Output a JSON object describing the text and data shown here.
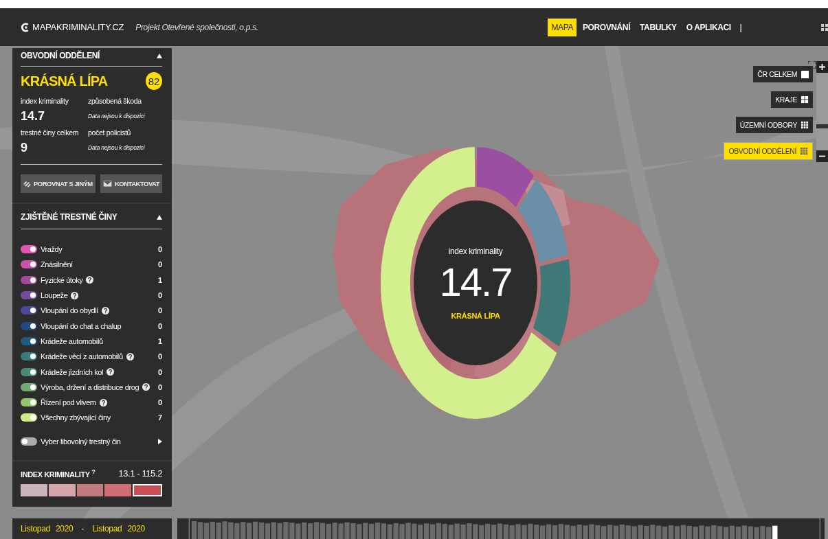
{
  "topbar": {
    "logo": "MAPAKRIMINALITY.CZ",
    "tagline": "Projekt Otevřené společnosti, o.p.s.",
    "separator": "|",
    "nav": [
      {
        "label": "MAPA",
        "selected": true
      },
      {
        "label": "POROVNÁNÍ",
        "selected": false
      },
      {
        "label": "TABULKY",
        "selected": false
      },
      {
        "label": "O APLIKACI",
        "selected": false
      }
    ]
  },
  "panel": {
    "section": "OBVODNÍ ODDĚLENÍ",
    "section_expanded": true,
    "place": "KRÁSNÁ LÍPA",
    "rank": "82",
    "stats": [
      {
        "label": "index kriminality",
        "value": "14.7",
        "kind": "value"
      },
      {
        "label": "způsobená škoda",
        "value": "Data nejsou k dispozici",
        "kind": "note"
      },
      {
        "label": "trestné činy celkem",
        "value": "9",
        "kind": "value"
      },
      {
        "label": "počet policistů",
        "value": "Data nejsou k dispozici",
        "kind": "note"
      }
    ],
    "buttons": [
      {
        "label": "POROVNAT S JINÝM",
        "kind": "compare"
      },
      {
        "label": "KONTAKTOVAT",
        "kind": "contact"
      }
    ],
    "crimes": {
      "title": "ZJIŠTĚNÉ TRESTNÉ ČINY",
      "expanded": true,
      "items": [
        {
          "label": "Vraždy",
          "count": "0",
          "color": "#e055b5",
          "on": true,
          "help": false
        },
        {
          "label": "Znásilnění",
          "count": "0",
          "color": "#c852a8",
          "on": true,
          "help": false
        },
        {
          "label": "Fyzické útoky",
          "count": "1",
          "color": "#a04a9e",
          "on": true,
          "help": true
        },
        {
          "label": "Loupeže",
          "count": "0",
          "color": "#7a4a9a",
          "on": true,
          "help": true
        },
        {
          "label": "Vloupání do obydlí",
          "count": "0",
          "color": "#4a4a95",
          "on": true,
          "help": true
        },
        {
          "label": "Vloupání do chat a chalup",
          "count": "0",
          "color": "#1f4a82",
          "on": true,
          "help": false
        },
        {
          "label": "Krádeže automobilů",
          "count": "1",
          "color": "#1f5a80",
          "on": true,
          "help": false
        },
        {
          "label": "Krádeže věcí z automobilů",
          "count": "0",
          "color": "#3a7a7c",
          "on": true,
          "help": true
        },
        {
          "label": "Krádeže jízdních kol",
          "count": "0",
          "color": "#4a8a72",
          "on": true,
          "help": true
        },
        {
          "label": "Výroba, držení a distribuce drog",
          "count": "0",
          "color": "#72a872",
          "on": true,
          "help": true
        },
        {
          "label": "Řízení pod vlivem",
          "count": "0",
          "color": "#94c672",
          "on": true,
          "help": true
        },
        {
          "label": "Všechny zbývající činy",
          "count": "7",
          "color": "#cbea86",
          "on": true,
          "help": false
        }
      ],
      "picker": {
        "label": "Vyber libovolný trestný čin",
        "on": false
      }
    },
    "index_legend": {
      "title": "INDEX KRIMINALITY $^{?}$",
      "range": "13.1 - 115.2",
      "swatches": [
        {
          "color": "#c9b5b9",
          "selected": false
        },
        {
          "color": "#d4a5aa",
          "selected": false
        },
        {
          "color": "#c07a80",
          "selected": false
        },
        {
          "color": "#d06d75",
          "selected": false
        },
        {
          "color": "#c85055",
          "selected": true
        }
      ]
    }
  },
  "layers": [
    {
      "label": "ČR CELKEM",
      "kind": "single",
      "selected": false
    },
    {
      "label": "KRAJE",
      "kind": "grid2",
      "selected": false
    },
    {
      "label": "ÚZEMNÍ ODBORY",
      "kind": "grid3",
      "selected": false
    },
    {
      "label": "OBVODNÍ ODDĚLENÍ",
      "kind": "grid4",
      "selected": true
    }
  ],
  "zoom": {
    "level": 0.3
  },
  "donut": {
    "caption": "index kriminality",
    "value": "14.7",
    "place": "KRÁSNÁ LÍPA"
  },
  "period": {
    "from_month": "Listopad",
    "from_year": "2020",
    "dash": "-",
    "to_month": "Listopad",
    "to_year": "2020"
  }
}
